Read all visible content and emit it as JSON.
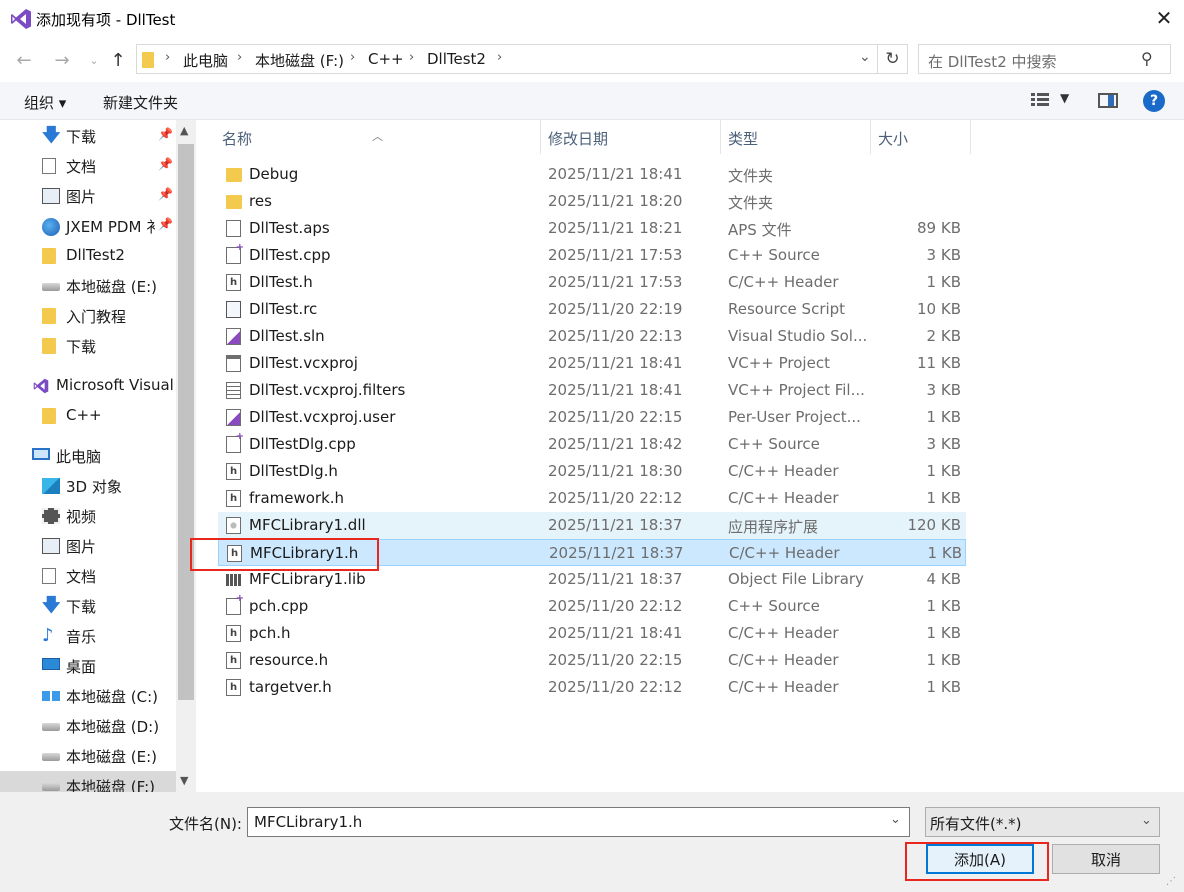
{
  "window": {
    "title": "添加现有项 - DllTest",
    "close_icon": "close-icon"
  },
  "nav": {
    "breadcrumb": [
      "此电脑",
      "本地磁盘 (F:)",
      "C++",
      "DllTest2"
    ],
    "search_placeholder": "在 DllTest2 中搜索"
  },
  "toolbar": {
    "organize": "组织 ▾",
    "new_folder": "新建文件夹"
  },
  "sidebar": {
    "items": [
      {
        "label": "下载",
        "icon": "download-icon",
        "pinned": true
      },
      {
        "label": "文档",
        "icon": "document-icon",
        "pinned": true
      },
      {
        "label": "图片",
        "icon": "pictures-icon",
        "pinned": true
      },
      {
        "label": "JXEM PDM 衤",
        "icon": "globe-icon",
        "pinned": true
      },
      {
        "label": "DllTest2",
        "icon": "folder-icon"
      },
      {
        "label": "本地磁盘 (E:)",
        "icon": "drive-icon"
      },
      {
        "label": "入门教程",
        "icon": "folder-icon"
      },
      {
        "label": "下载",
        "icon": "folder-icon"
      },
      {
        "label": "Microsoft Visual",
        "icon": "visual-studio-icon"
      },
      {
        "label": "C++",
        "icon": "folder-icon"
      },
      {
        "label": "此电脑",
        "icon": "this-pc-icon"
      },
      {
        "label": "3D 对象",
        "icon": "3d-objects-icon"
      },
      {
        "label": "视频",
        "icon": "videos-icon"
      },
      {
        "label": "图片",
        "icon": "pictures-icon"
      },
      {
        "label": "文档",
        "icon": "document-icon"
      },
      {
        "label": "下载",
        "icon": "download-icon"
      },
      {
        "label": "音乐",
        "icon": "music-icon"
      },
      {
        "label": "桌面",
        "icon": "desktop-icon"
      },
      {
        "label": "本地磁盘 (C:)",
        "icon": "windows-drive-icon"
      },
      {
        "label": "本地磁盘 (D:)",
        "icon": "drive-icon"
      },
      {
        "label": "本地磁盘 (E:)",
        "icon": "drive-icon"
      },
      {
        "label": "本地磁盘 (F:)",
        "icon": "drive-icon"
      }
    ]
  },
  "files": {
    "columns": {
      "name": "名称",
      "date": "修改日期",
      "type": "类型",
      "size": "大小"
    },
    "rows": [
      {
        "name": "Debug",
        "date": "2025/11/21 18:41",
        "type": "文件夹",
        "size": "",
        "icon": "folder-icon"
      },
      {
        "name": "res",
        "date": "2025/11/21 18:20",
        "type": "文件夹",
        "size": "",
        "icon": "folder-icon"
      },
      {
        "name": "DllTest.aps",
        "date": "2025/11/21 18:21",
        "type": "APS 文件",
        "size": "89 KB",
        "icon": "file-icon"
      },
      {
        "name": "DllTest.cpp",
        "date": "2025/11/21 17:53",
        "type": "C++ Source",
        "size": "3 KB",
        "icon": "cpp-file-icon"
      },
      {
        "name": "DllTest.h",
        "date": "2025/11/21 17:53",
        "type": "C/C++ Header",
        "size": "1 KB",
        "icon": "header-file-icon"
      },
      {
        "name": "DllTest.rc",
        "date": "2025/11/20 22:19",
        "type": "Resource Script",
        "size": "10 KB",
        "icon": "resource-file-icon"
      },
      {
        "name": "DllTest.sln",
        "date": "2025/11/20 22:13",
        "type": "Visual Studio Sol...",
        "size": "2 KB",
        "icon": "solution-file-icon"
      },
      {
        "name": "DllTest.vcxproj",
        "date": "2025/11/21 18:41",
        "type": "VC++ Project",
        "size": "11 KB",
        "icon": "project-file-icon"
      },
      {
        "name": "DllTest.vcxproj.filters",
        "date": "2025/11/21 18:41",
        "type": "VC++ Project Fil...",
        "size": "3 KB",
        "icon": "filters-file-icon"
      },
      {
        "name": "DllTest.vcxproj.user",
        "date": "2025/11/20 22:15",
        "type": "Per-User Project...",
        "size": "1 KB",
        "icon": "user-file-icon"
      },
      {
        "name": "DllTestDlg.cpp",
        "date": "2025/11/21 18:42",
        "type": "C++ Source",
        "size": "3 KB",
        "icon": "cpp-file-icon"
      },
      {
        "name": "DllTestDlg.h",
        "date": "2025/11/21 18:30",
        "type": "C/C++ Header",
        "size": "1 KB",
        "icon": "header-file-icon"
      },
      {
        "name": "framework.h",
        "date": "2025/11/20 22:12",
        "type": "C/C++ Header",
        "size": "1 KB",
        "icon": "header-file-icon"
      },
      {
        "name": "MFCLibrary1.dll",
        "date": "2025/11/21 18:37",
        "type": "应用程序扩展",
        "size": "120 KB",
        "icon": "dll-file-icon",
        "state": "hover"
      },
      {
        "name": "MFCLibrary1.h",
        "date": "2025/11/21 18:37",
        "type": "C/C++ Header",
        "size": "1 KB",
        "icon": "header-file-icon",
        "state": "selected"
      },
      {
        "name": "MFCLibrary1.lib",
        "date": "2025/11/21 18:37",
        "type": "Object File Library",
        "size": "4 KB",
        "icon": "lib-file-icon"
      },
      {
        "name": "pch.cpp",
        "date": "2025/11/20 22:12",
        "type": "C++ Source",
        "size": "1 KB",
        "icon": "cpp-file-icon"
      },
      {
        "name": "pch.h",
        "date": "2025/11/21 18:41",
        "type": "C/C++ Header",
        "size": "1 KB",
        "icon": "header-file-icon"
      },
      {
        "name": "resource.h",
        "date": "2025/11/20 22:15",
        "type": "C/C++ Header",
        "size": "1 KB",
        "icon": "header-file-icon"
      },
      {
        "name": "targetver.h",
        "date": "2025/11/20 22:12",
        "type": "C/C++ Header",
        "size": "1 KB",
        "icon": "header-file-icon"
      }
    ]
  },
  "bottom": {
    "filename_label": "文件名(N):",
    "filename_value": "MFCLibrary1.h",
    "filetype_value": "所有文件(*.*)",
    "add_button": "添加(A)",
    "cancel_button": "取消"
  },
  "colors": {
    "selection": "#cce8ff",
    "hover": "#e5f3fb",
    "highlight_box": "#e8271e",
    "accent": "#0078d7"
  }
}
